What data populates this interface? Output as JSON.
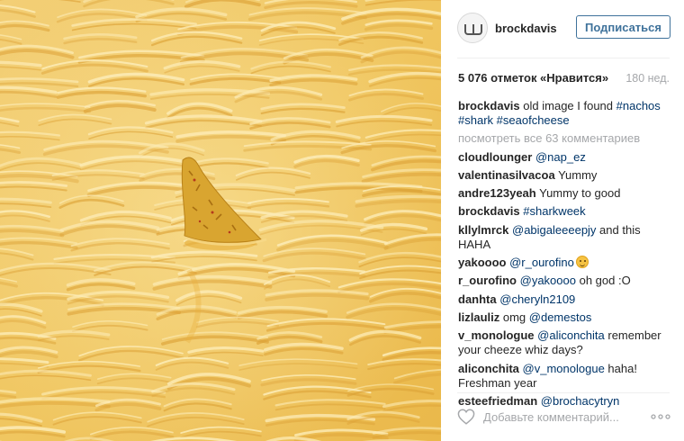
{
  "photo": {
    "description_icon": "nacho-fin-in-cheese",
    "colors": {
      "cheese_light": "#f7d784",
      "cheese_mid": "#eebd46",
      "cheese_dark": "#d99a20",
      "chip": "#d9a530"
    }
  },
  "header": {
    "username": "brockdavis",
    "follow_label": "Подписаться",
    "avatar_icon": "avatar-icon"
  },
  "stats": {
    "likes": "5 076 отметок «Нравится»",
    "time": "180 нед."
  },
  "comments": [
    {
      "user": "brockdavis",
      "parts": [
        {
          "text": "old image I found "
        },
        {
          "tag": "#nachos"
        },
        {
          "text": " "
        },
        {
          "tag": "#shark"
        },
        {
          "text": " "
        },
        {
          "tag": "#seaofcheese"
        }
      ]
    },
    {
      "more": "посмотреть все 63 комментариев"
    },
    {
      "user": "cloudlounger",
      "parts": [
        {
          "tag": "@nap_ez"
        }
      ]
    },
    {
      "user": "valentinasilvacoa",
      "parts": [
        {
          "text": "Yummy"
        }
      ]
    },
    {
      "user": "andre123yeah",
      "parts": [
        {
          "text": "Yummy to good"
        }
      ]
    },
    {
      "user": "brockdavis",
      "parts": [
        {
          "tag": "#sharkweek"
        }
      ]
    },
    {
      "user": "kllylmrck",
      "parts": [
        {
          "tag": "@abigaleeeepjy"
        },
        {
          "text": " and this HAHA"
        }
      ]
    },
    {
      "user": "yakoooo",
      "parts": [
        {
          "tag": "@r_ourofino"
        },
        {
          "emoji": "smirk-emoji"
        }
      ]
    },
    {
      "user": "r_ourofino",
      "parts": [
        {
          "tag": "@yakoooo"
        },
        {
          "text": " oh god :O"
        }
      ]
    },
    {
      "user": "danhta",
      "parts": [
        {
          "tag": "@cheryln2109"
        }
      ]
    },
    {
      "user": "lizlauliz",
      "parts": [
        {
          "text": "omg "
        },
        {
          "tag": "@demestos"
        }
      ]
    },
    {
      "user": "v_monologue",
      "parts": [
        {
          "tag": "@aliconchita"
        },
        {
          "text": " remember your cheeze whiz days?"
        }
      ]
    },
    {
      "user": "aliconchita",
      "parts": [
        {
          "tag": "@v_monologue"
        },
        {
          "text": " haha! Freshman year"
        }
      ]
    },
    {
      "user": "esteefriedman",
      "parts": [
        {
          "tag": "@brochacytryn"
        }
      ]
    }
  ],
  "footer": {
    "comment_placeholder": "Добавьте комментарий...",
    "like_icon": "heart-icon",
    "options_icon": "more-options-icon"
  },
  "colors": {
    "link": "#003569",
    "follow_blue": "#3f729b",
    "muted": "#a5a7aa",
    "text": "#262626"
  }
}
